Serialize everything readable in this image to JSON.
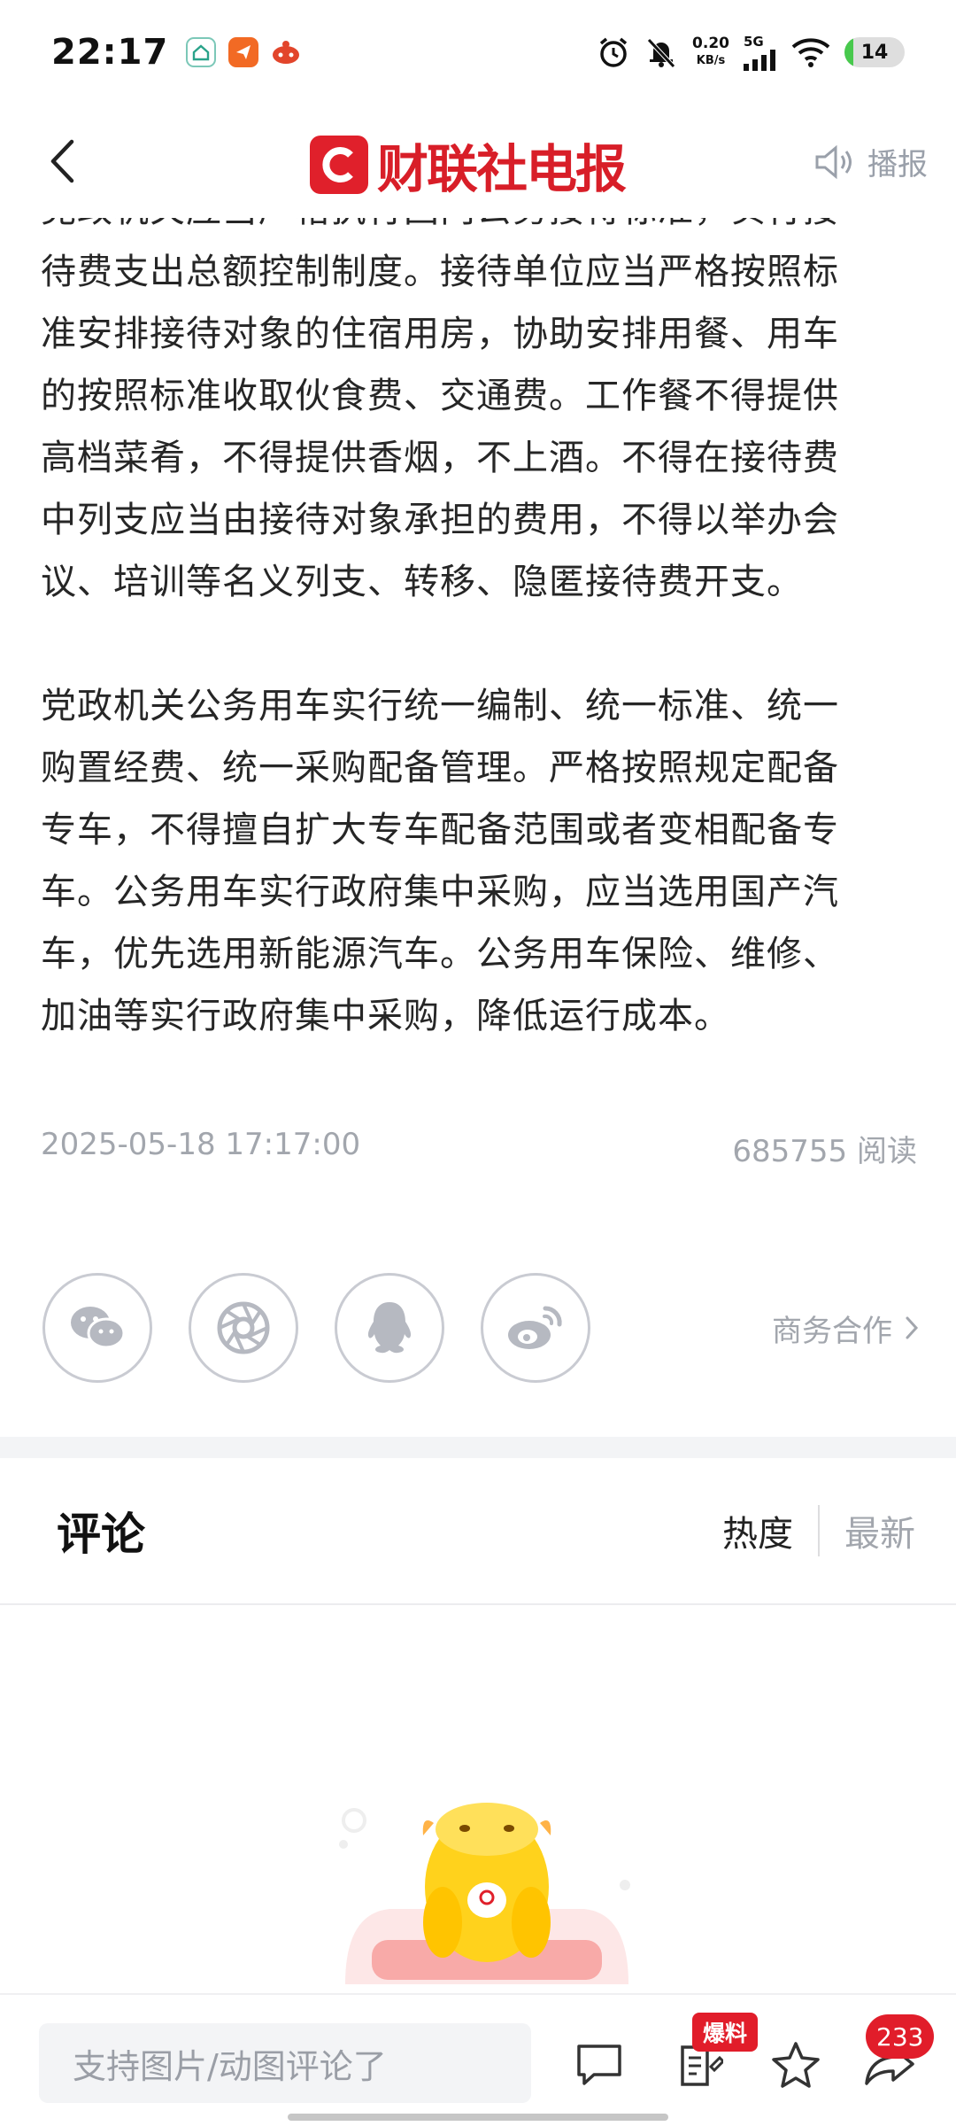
{
  "status_bar": {
    "time": "22:17",
    "speed_value": "0.20",
    "speed_unit": "KB/s",
    "network": "5G",
    "battery": "14",
    "battery_level": 0.14
  },
  "header": {
    "logo_text": "财联社电报",
    "broadcast_label": "播报"
  },
  "article": {
    "cut_line": "党政机关应当严格执行国内公务接待标准，实行接",
    "paragraph1_lines": [
      "待费支出总额控制制度。接待单位应当严格按照标",
      "准安排接待对象的住宿用房，协助安排用餐、用车",
      "的按照标准收取伙食费、交通费。工作餐不得提供",
      "高档菜肴，不得提供香烟，不上酒。不得在接待费",
      "中列支应当由接待对象承担的费用，不得以举办会",
      "议、培训等名义列支、转移、隐匿接待费开支。"
    ],
    "paragraph2_lines": [
      "党政机关公务用车实行统一编制、统一标准、统一",
      "购置经费、统一采购配备管理。严格按照规定配备",
      "专车，不得擅自扩大专车配备范围或者变相配备专",
      "车。公务用车实行政府集中采购，应当选用国产汽",
      "车，优先选用新能源汽车。公务用车保险、维修、",
      "加油等实行政府集中采购，降低运行成本。"
    ],
    "datetime": "2025-05-18 17:17:00",
    "reads": "685755 阅读"
  },
  "share": {
    "icons": [
      "wechat-icon",
      "moments-icon",
      "qq-icon",
      "weibo-icon"
    ],
    "business_label": "商务合作"
  },
  "comments": {
    "title": "评论",
    "sort_hot": "热度",
    "sort_new": "最新"
  },
  "bottom_bar": {
    "input_placeholder": "支持图片/动图评论了",
    "tip_badge": "爆料",
    "share_count": "233"
  },
  "colors": {
    "brand_red": "#e0202b",
    "muted_text": "#a2a6ad",
    "battery_green": "#48c94d"
  }
}
